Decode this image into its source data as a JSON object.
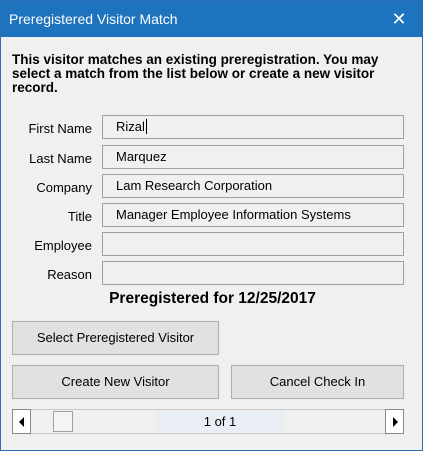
{
  "window": {
    "title": "Preregistered Visitor Match",
    "close_glyph": "✕"
  },
  "intro_text": "This visitor matches an existing preregistration. You may select a match from the list below or create a new visitor record.",
  "fields": [
    {
      "label": "First Name",
      "value": "Rizal"
    },
    {
      "label": "Last Name",
      "value": "Marquez"
    },
    {
      "label": "Company",
      "value": "Lam Research Corporation"
    },
    {
      "label": "Title",
      "value": "Manager Employee Information Systems"
    },
    {
      "label": "Employee",
      "value": ""
    },
    {
      "label": "Reason",
      "value": ""
    }
  ],
  "preregistered_text": "Preregistered for 12/25/2017",
  "buttons": {
    "select_preregistered": "Select Preregistered Visitor",
    "create_new": "Create New Visitor",
    "cancel_checkin": "Cancel Check In"
  },
  "navigator": {
    "counter": "1 of 1",
    "left_icon": "arrow-left-icon",
    "right_icon": "arrow-right-icon"
  },
  "colors": {
    "titlebar": "#1e73be",
    "background": "#f0f0f0",
    "button_face": "#e1e1e1"
  }
}
